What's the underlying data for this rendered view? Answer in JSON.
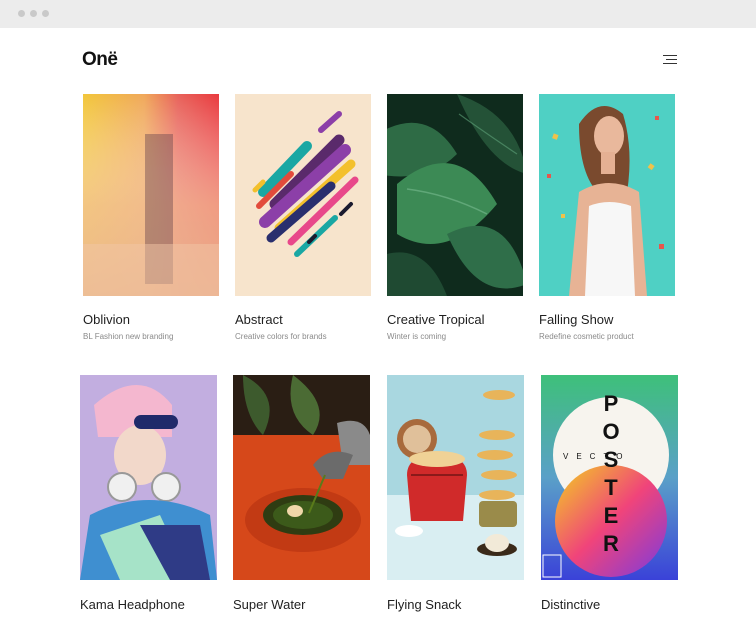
{
  "site": {
    "logo": "Onë"
  },
  "header": {
    "menu_icon": "hamburger-menu-icon"
  },
  "projects": [
    {
      "title": "Oblivion",
      "subtitle": "BL Fashion new branding"
    },
    {
      "title": "Abstract",
      "subtitle": "Creative colors for brands"
    },
    {
      "title": "Creative Tropical",
      "subtitle": "Winter is coming"
    },
    {
      "title": "Falling Show",
      "subtitle": "Redefine cosmetic product"
    },
    {
      "title": "Kama Headphone",
      "subtitle": ""
    },
    {
      "title": "Super Water",
      "subtitle": ""
    },
    {
      "title": "Flying Snack",
      "subtitle": ""
    },
    {
      "title": "Distinctive",
      "subtitle": ""
    }
  ],
  "poster_art": {
    "vertical_text": "POSTER",
    "horizontal_text": "VECTO"
  },
  "colors": {
    "background": "#ffffff",
    "chrome": "#ececec",
    "title": "#1f1f1f",
    "subtitle": "#8a8a8a"
  }
}
